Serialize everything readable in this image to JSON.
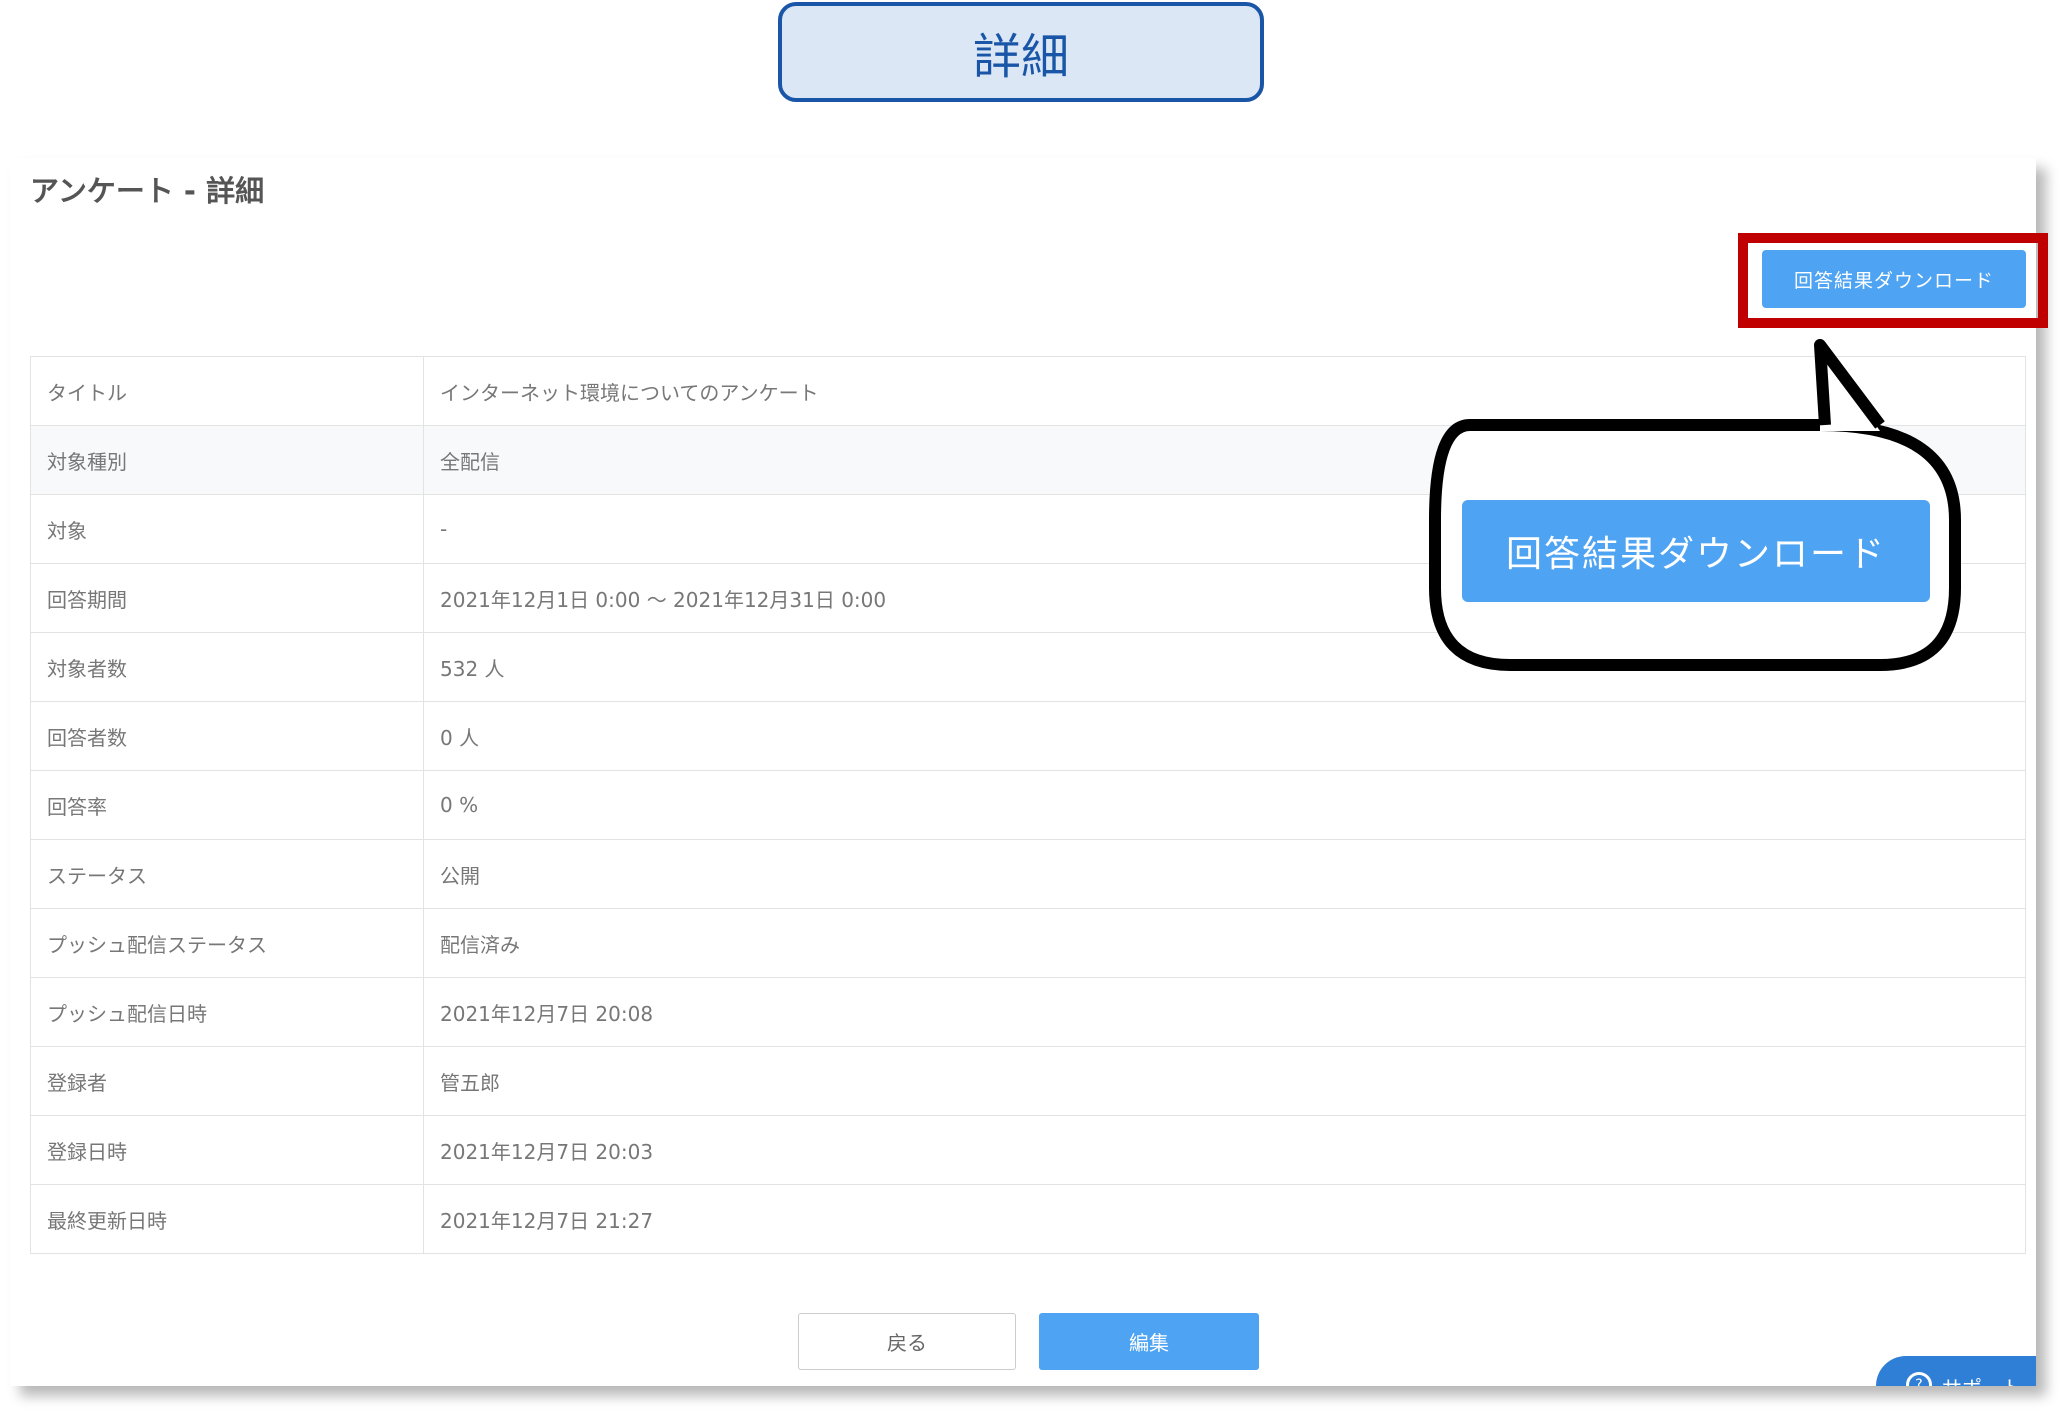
{
  "header_label": "詳細",
  "page_title": "アンケート - 詳細",
  "download_button_label": "回答結果ダウンロード",
  "callout_label": "回答結果ダウンロード",
  "rows": [
    {
      "label": "タイトル",
      "value": "インターネット環境についてのアンケート"
    },
    {
      "label": "対象種別",
      "value": "全配信"
    },
    {
      "label": "対象",
      "value": "-"
    },
    {
      "label": "回答期間",
      "value": "2021年12月1日 0:00 〜 2021年12月31日 0:00"
    },
    {
      "label": "対象者数",
      "value": "532 人"
    },
    {
      "label": "回答者数",
      "value": "0 人"
    },
    {
      "label": "回答率",
      "value": "0 %"
    },
    {
      "label": "ステータス",
      "value": "公開"
    },
    {
      "label": "プッシュ配信ステータス",
      "value": "配信済み"
    },
    {
      "label": "プッシュ配信日時",
      "value": "2021年12月7日 20:08"
    },
    {
      "label": "登録者",
      "value": "管五郎"
    },
    {
      "label": "登録日時",
      "value": "2021年12月7日 20:03"
    },
    {
      "label": "最終更新日時",
      "value": "2021年12月7日 21:27"
    }
  ],
  "back_button_label": "戻る",
  "edit_button_label": "編集",
  "support_label": "サポート",
  "colors": {
    "primary_button": "#4ea3f2",
    "highlight_border": "#c00000",
    "header_label_border": "#1a56a8",
    "header_label_bg": "#dbe7f5"
  }
}
